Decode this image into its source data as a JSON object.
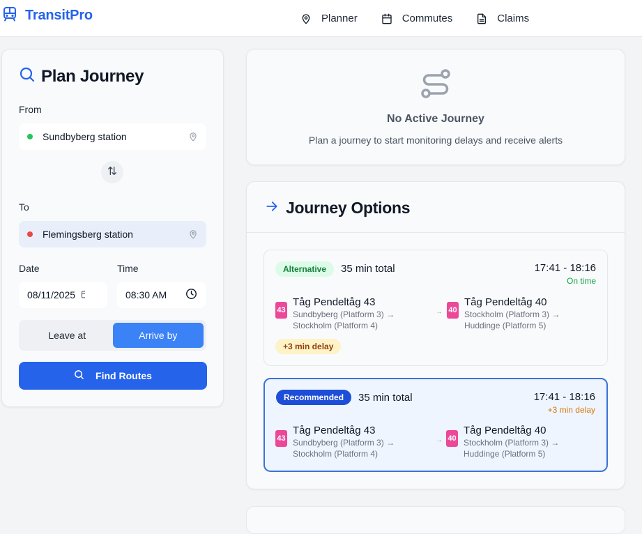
{
  "app": {
    "name": "TransitPro"
  },
  "nav": {
    "items": [
      {
        "label": "Planner",
        "icon": "map-pin-icon"
      },
      {
        "label": "Commutes",
        "icon": "calendar-icon"
      },
      {
        "label": "Claims",
        "icon": "document-icon"
      }
    ]
  },
  "planner": {
    "title": "Plan Journey",
    "from_label": "From",
    "from_value": "Sundbyberg station",
    "to_label": "To",
    "to_value": "Flemingsberg station",
    "date_label": "Date",
    "date_value": "08/11/2025",
    "time_label": "Time",
    "time_value": "08:30 AM",
    "toggle": {
      "leave_at": "Leave at",
      "arrive_by": "Arrive by",
      "selected": "arrive_by"
    },
    "find_button": "Find Routes"
  },
  "active": {
    "title": "No Active Journey",
    "subtitle": "Plan a journey to start monitoring delays and receive alerts"
  },
  "options": {
    "title": "Journey Options",
    "routes": [
      {
        "badge": "Alternative",
        "total": "35 min total",
        "times": "17:41 - 18:16",
        "status": "On time",
        "legs": [
          {
            "line": "43",
            "name": "Tåg Pendeltåg 43",
            "from": "Sundbyberg (Platform 3) →",
            "to": "Stockholm (Platform 4)"
          },
          {
            "line": "40",
            "name": "Tåg Pendeltåg 40",
            "from": "Stockholm (Platform 3) →",
            "to": "Huddinge (Platform 5)"
          }
        ],
        "delay_chip": "+3 min delay"
      },
      {
        "badge": "Recommended",
        "total": "35 min total",
        "times": "17:41 - 18:16",
        "status": "+3 min delay",
        "legs": [
          {
            "line": "43",
            "name": "Tåg Pendeltåg 43",
            "from": "Sundbyberg (Platform 3) →",
            "to": "Stockholm (Platform 4)"
          },
          {
            "line": "40",
            "name": "Tåg Pendeltåg 40",
            "from": "Stockholm (Platform 3) →",
            "to": "Huddinge (Platform 5)"
          }
        ]
      }
    ]
  },
  "colors": {
    "brand": "#2563eb",
    "line_badge": "#ec4899",
    "on_time": "#16a34a",
    "delay": "#d97706"
  }
}
